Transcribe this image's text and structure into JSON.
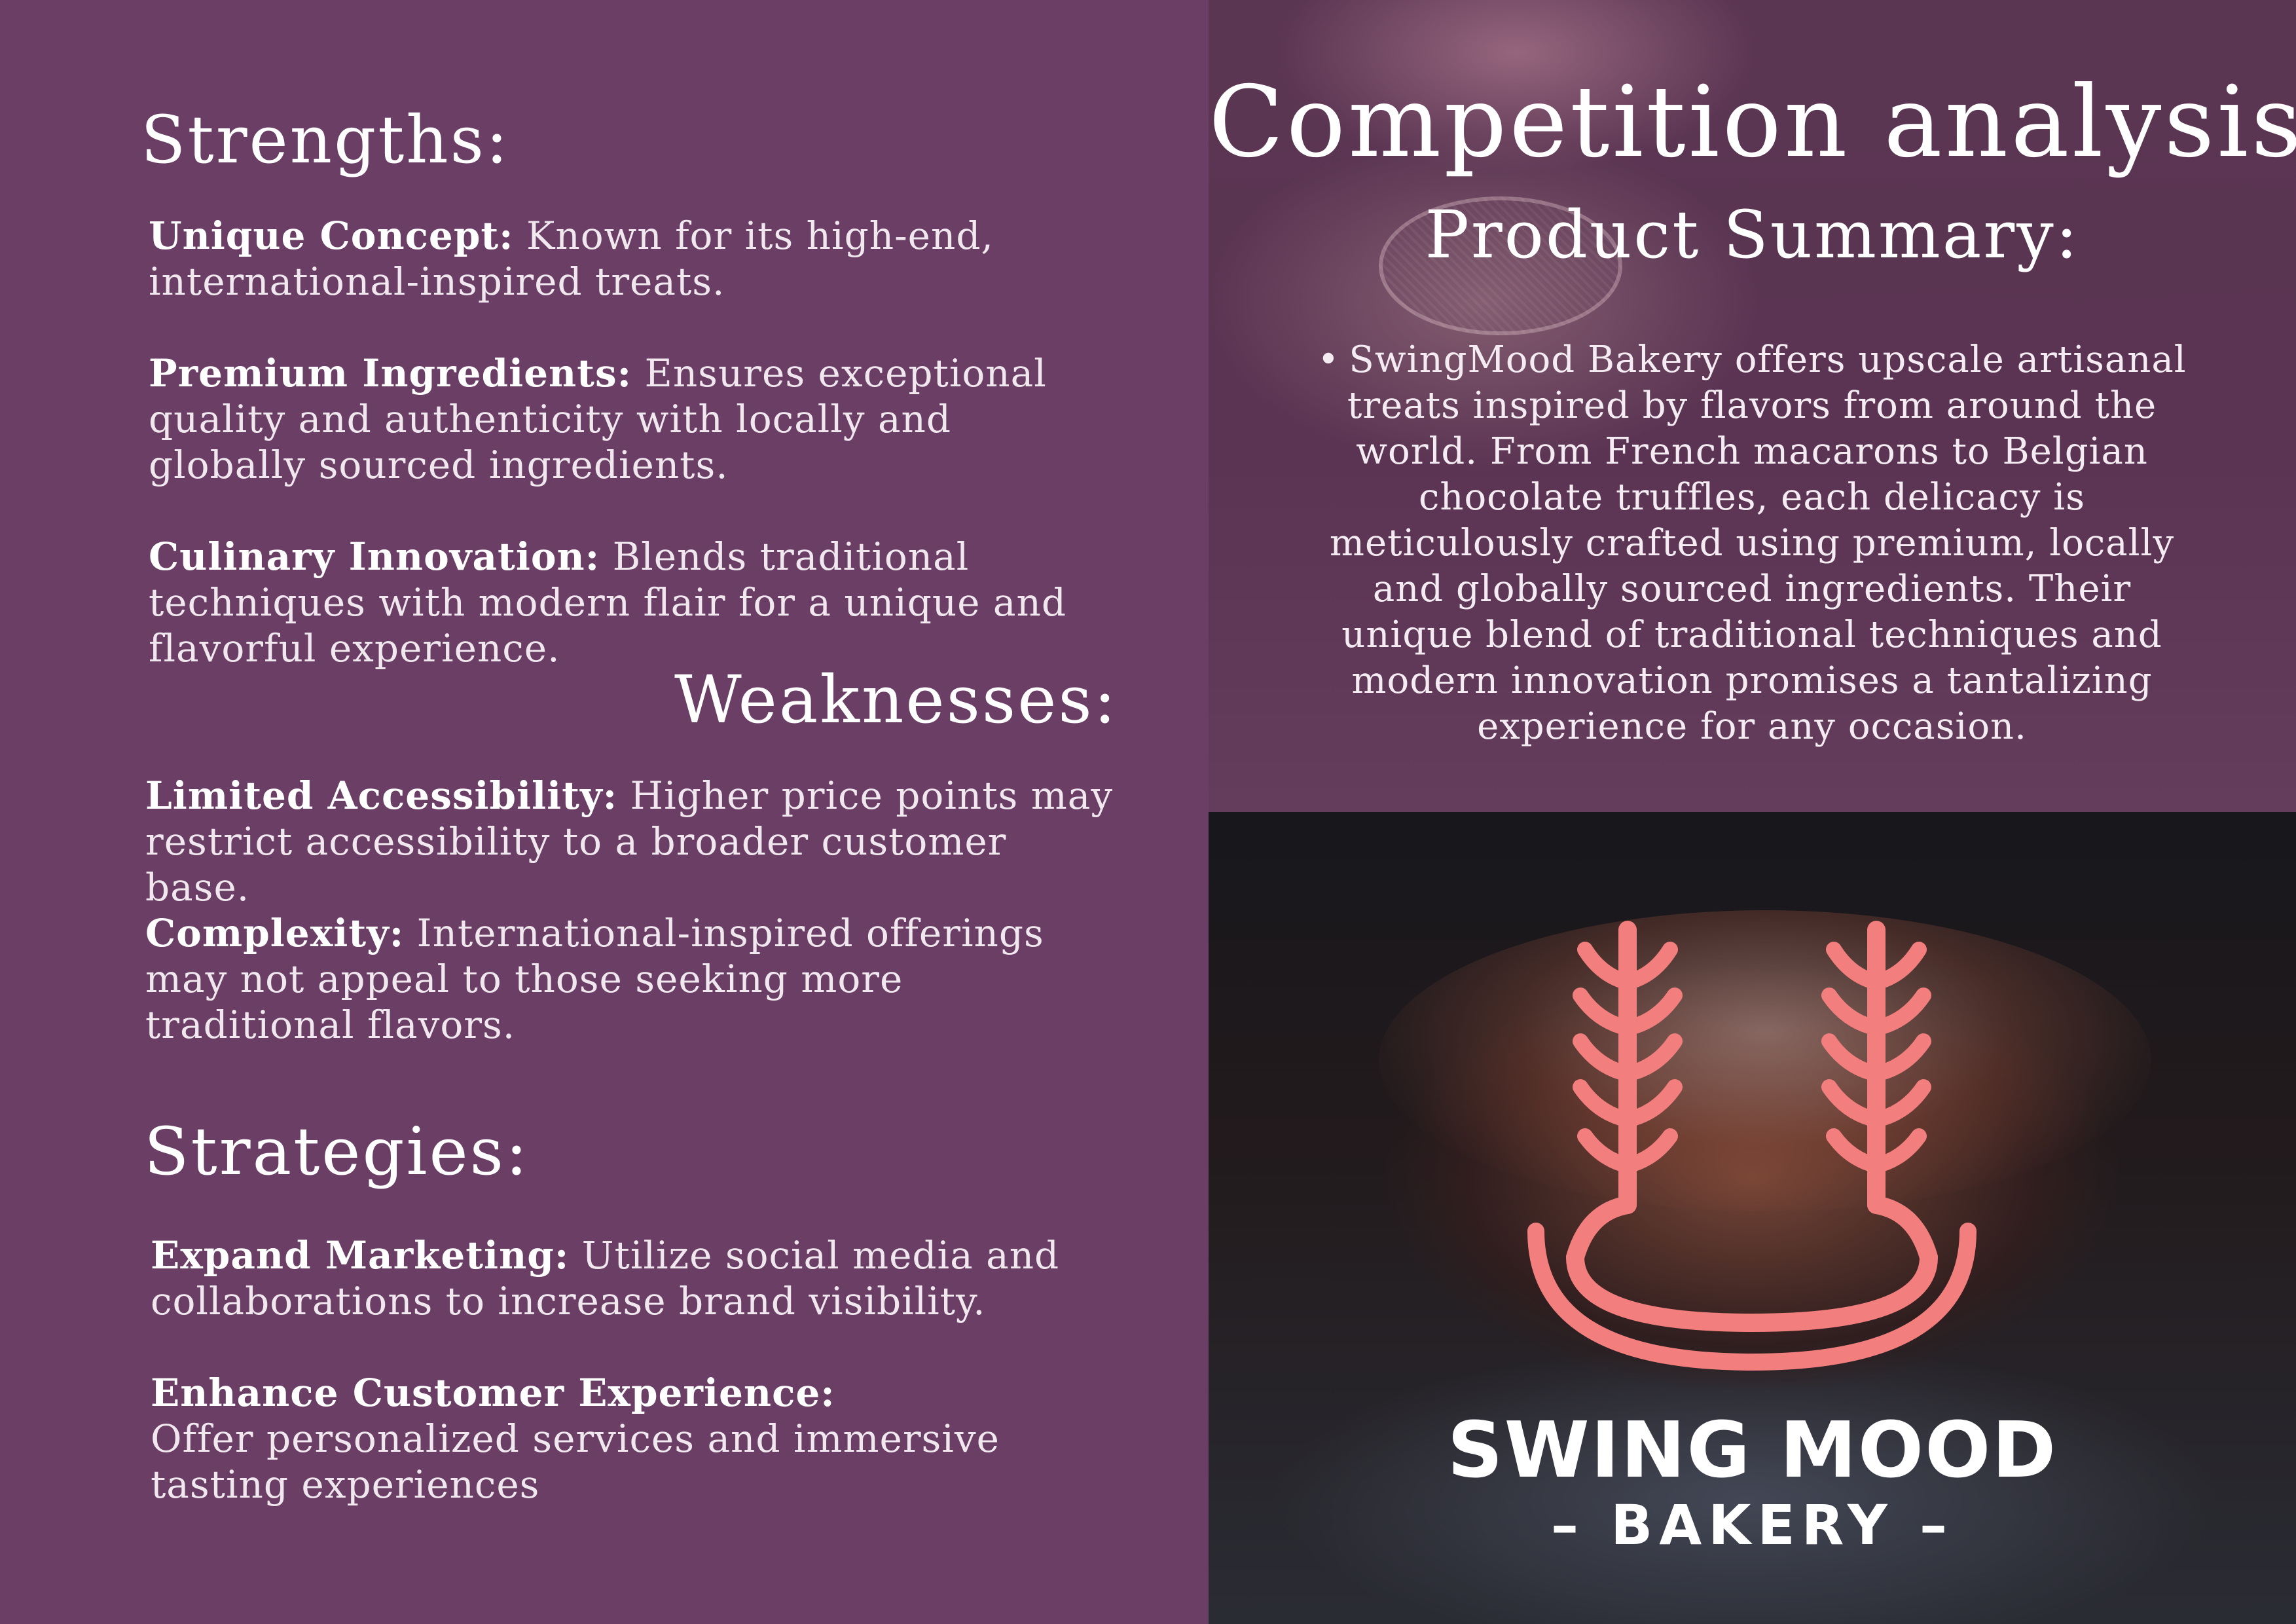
{
  "left": {
    "strengths": {
      "heading": "Strengths:",
      "items": [
        {
          "term": "Unique Concept:",
          "text": "Known for its high-end, international-inspired treats."
        },
        {
          "term": "Premium Ingredients:",
          "text": "Ensures exceptional quality and authenticity with locally and globally sourced ingredients."
        },
        {
          "term": "Culinary Innovation:",
          "text": "Blends traditional techniques with modern flair for a unique and flavorful experience."
        }
      ]
    },
    "weaknesses": {
      "heading": "Weaknesses:",
      "items": [
        {
          "term": "Limited Accessibility:",
          "text": "Higher price points may restrict accessibility to a broader customer base."
        },
        {
          "term": "Complexity:",
          "text": "International-inspired offerings may not appeal to those seeking more traditional flavors."
        }
      ]
    },
    "strategies": {
      "heading": "Strategies:",
      "items": [
        {
          "term": "Expand Marketing:",
          "text": "Utilize social media and collaborations to increase brand visibility."
        },
        {
          "term": "Enhance Customer Experience:",
          "text": "Offer personalized services and immersive tasting experiences"
        }
      ]
    }
  },
  "right": {
    "title": "Competition analysis",
    "subtitle": "Product Summary:",
    "bullet": "•",
    "summary": "SwingMood Bakery offers upscale artisanal treats inspired by flavors from around the world. From French macarons to Belgian chocolate truffles, each delicacy is meticulously crafted using premium, locally and globally sourced ingredients. Their unique blend of traditional techniques and modern innovation promises a tantalizing experience for any occasion."
  },
  "logo": {
    "name": "SWING MOOD",
    "sub": "– BAKERY –",
    "color": "#f37e7e"
  },
  "colors": {
    "panel": "#6b3f65",
    "accent": "#f37e7e"
  }
}
